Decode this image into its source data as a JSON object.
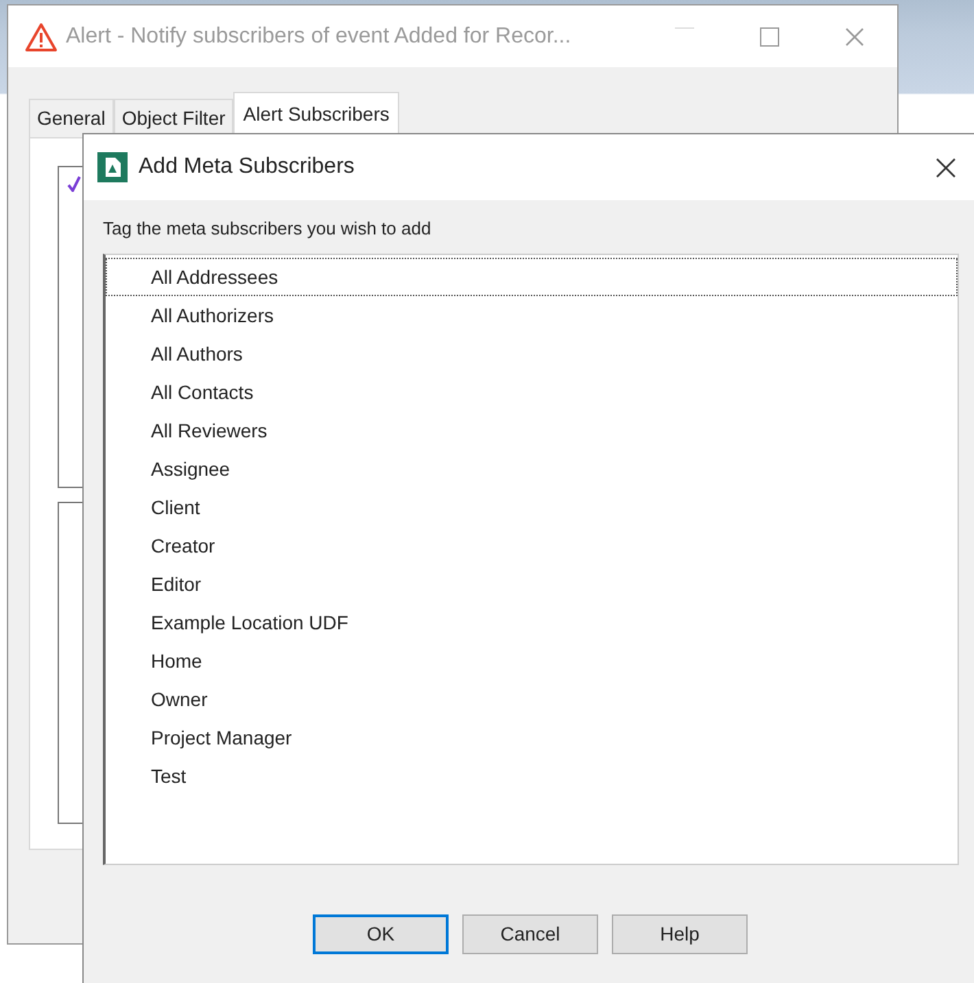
{
  "background_window": {
    "title": "Alert - Notify subscribers of event Added for Recor...",
    "tabs": [
      {
        "label": "General",
        "selected": false
      },
      {
        "label": "Object Filter",
        "selected": false
      },
      {
        "label": "Alert Subscribers",
        "selected": true
      }
    ],
    "panel_checked": true
  },
  "dialog": {
    "title": "Add Meta Subscribers",
    "prompt": "Tag the meta subscribers you wish to add",
    "items": [
      {
        "label": "All Addressees",
        "focused": true
      },
      {
        "label": "All Authorizers",
        "focused": false
      },
      {
        "label": "All Authors",
        "focused": false
      },
      {
        "label": "All Contacts",
        "focused": false
      },
      {
        "label": "All Reviewers",
        "focused": false
      },
      {
        "label": "Assignee",
        "focused": false
      },
      {
        "label": "Client",
        "focused": false
      },
      {
        "label": "Creator",
        "focused": false
      },
      {
        "label": "Editor",
        "focused": false
      },
      {
        "label": "Example Location UDF",
        "focused": false
      },
      {
        "label": "Home",
        "focused": false
      },
      {
        "label": "Owner",
        "focused": false
      },
      {
        "label": "Project Manager",
        "focused": false
      },
      {
        "label": "Test",
        "focused": false
      }
    ],
    "buttons": [
      {
        "label": "OK",
        "default": true
      },
      {
        "label": "Cancel",
        "default": false
      },
      {
        "label": "Help",
        "default": false
      }
    ]
  }
}
